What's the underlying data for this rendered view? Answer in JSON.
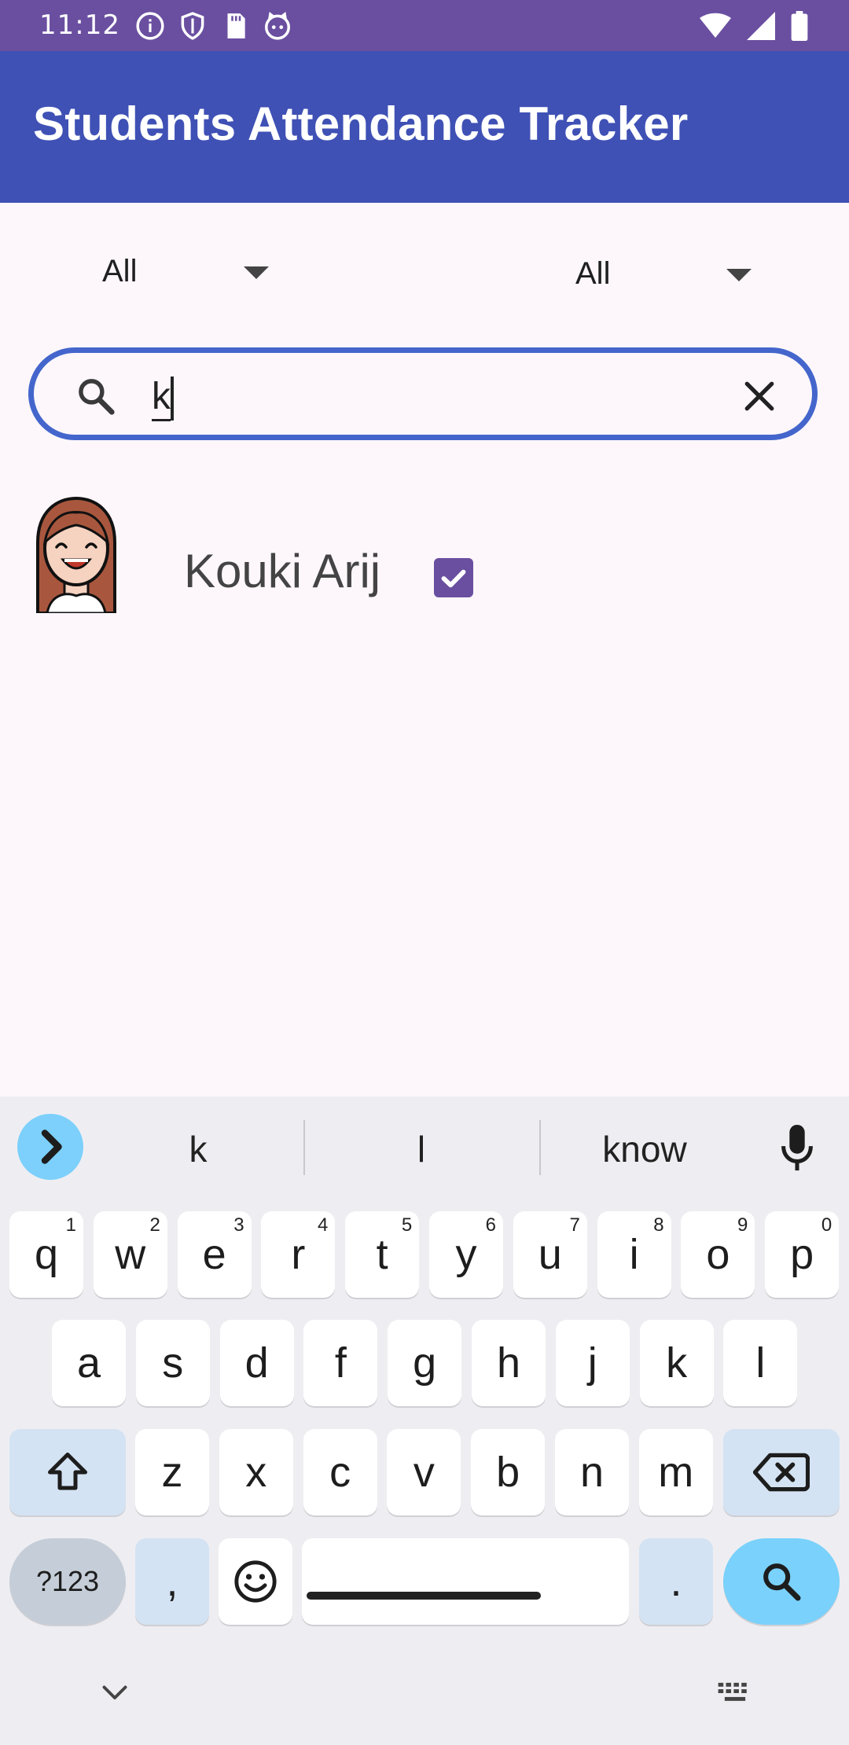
{
  "status_bar": {
    "time": "11:12"
  },
  "app_bar": {
    "title": "Students Attendance Tracker"
  },
  "filters": [
    {
      "value": "All"
    },
    {
      "value": "All"
    }
  ],
  "search": {
    "value": "k",
    "placeholder": ""
  },
  "students": [
    {
      "name": "Kouki Arij",
      "present": true
    }
  ],
  "keyboard": {
    "suggestions": [
      "k",
      "l",
      "know"
    ],
    "row1": [
      {
        "k": "q",
        "h": "1"
      },
      {
        "k": "w",
        "h": "2"
      },
      {
        "k": "e",
        "h": "3"
      },
      {
        "k": "r",
        "h": "4"
      },
      {
        "k": "t",
        "h": "5"
      },
      {
        "k": "y",
        "h": "6"
      },
      {
        "k": "u",
        "h": "7"
      },
      {
        "k": "i",
        "h": "8"
      },
      {
        "k": "o",
        "h": "9"
      },
      {
        "k": "p",
        "h": "0"
      }
    ],
    "row2": [
      "a",
      "s",
      "d",
      "f",
      "g",
      "h",
      "j",
      "k",
      "l"
    ],
    "row3": [
      "z",
      "x",
      "c",
      "v",
      "b",
      "n",
      "m"
    ],
    "symbols_label": "?123",
    "comma": ",",
    "period": "."
  },
  "colors": {
    "status_bar": "#6a4fa0",
    "app_bar": "#3f51b5",
    "search_border": "#4466cc",
    "checkbox": "#6a4fa0",
    "keyboard_accent": "#7ad1fb"
  }
}
